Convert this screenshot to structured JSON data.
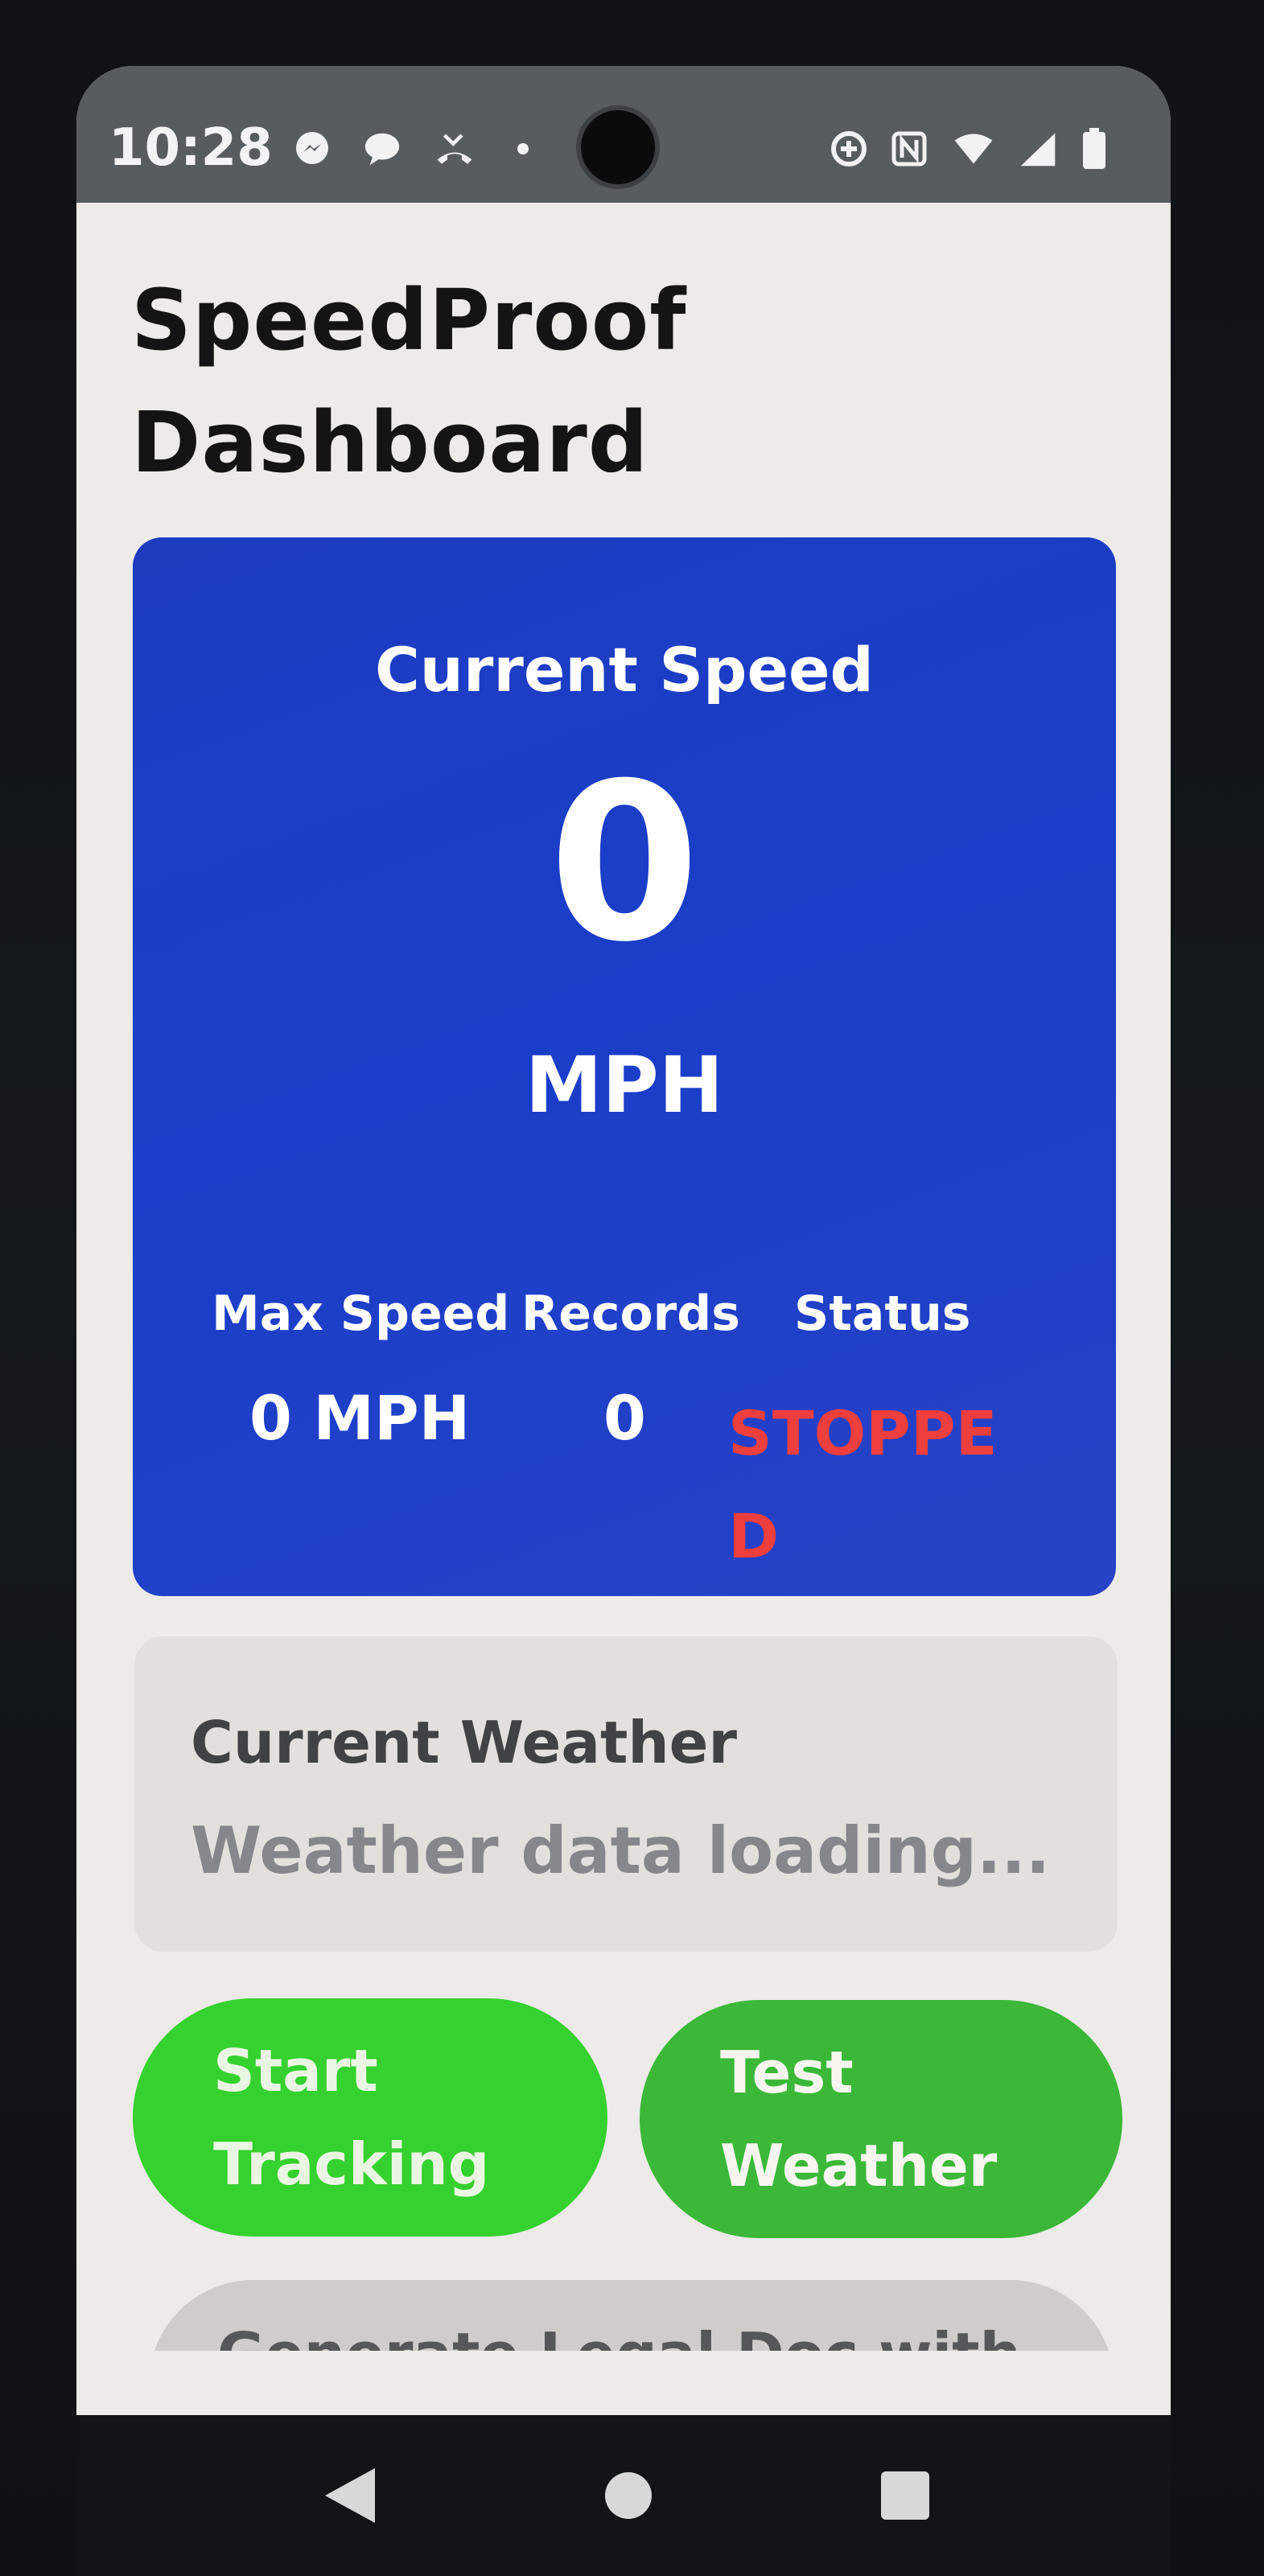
{
  "status_bar": {
    "time": "10:28",
    "left_icons": [
      "messenger-icon",
      "chat-bubble-icon",
      "missed-call-icon",
      "dot-icon"
    ],
    "right_icons": [
      "data-saver-icon",
      "nfc-icon",
      "wifi-icon",
      "signal-icon",
      "battery-icon"
    ]
  },
  "app": {
    "title": "SpeedProof Dashboard"
  },
  "speed_card": {
    "label": "Current Speed",
    "value": "0",
    "unit": "MPH",
    "max_speed_label": "Max Speed",
    "records_label": "Records",
    "status_label": "Status",
    "max_speed_value": "0 MPH",
    "records_value": "0",
    "status_value": "STOPPED",
    "card_color": "#1d3cc0",
    "status_color": "#ef3e3e"
  },
  "weather": {
    "title": "Current Weather",
    "text": "Weather data loading..."
  },
  "buttons": {
    "start_tracking": "Start\nTracking",
    "test_weather": "Test\nWeather",
    "legal_doc": "Generate Legal Doc with",
    "start_color": "#35d12e",
    "weather_color": "#3bb837"
  },
  "nav": {
    "icons": [
      "back-icon",
      "home-icon",
      "recents-icon"
    ]
  }
}
